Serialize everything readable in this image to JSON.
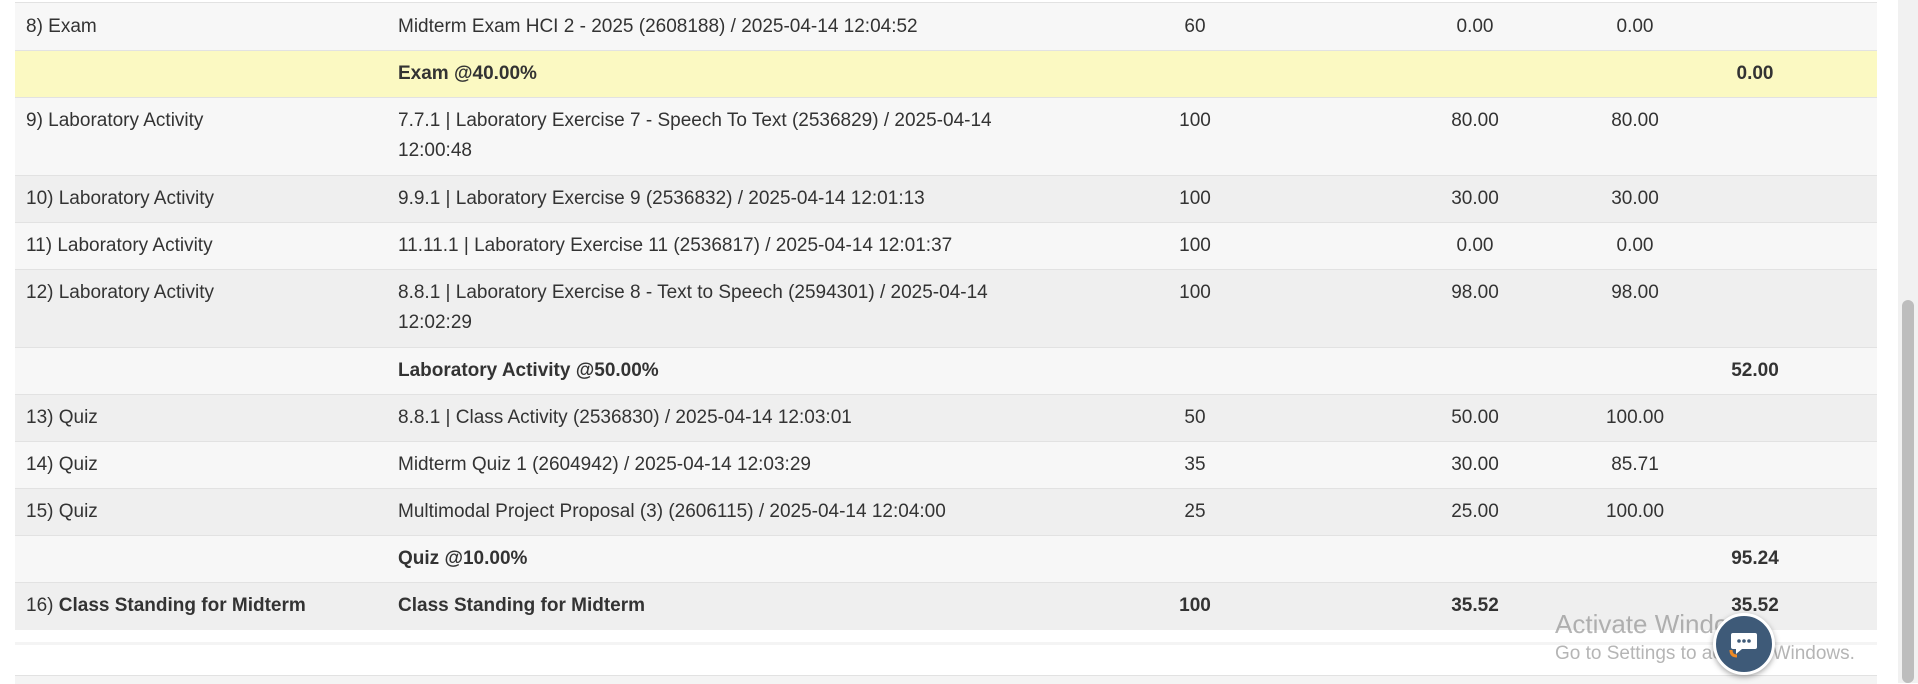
{
  "rows": [
    {
      "kind": "item",
      "name": "8) Exam",
      "desc": "Midterm Exam HCI 2 - 2025 (2608188) / 2025-04-14 12:04:52",
      "items": "60",
      "score": "0.00",
      "pct": "0.00",
      "grade": ""
    },
    {
      "kind": "subtotal",
      "name": "",
      "desc": "Exam @40.00%",
      "items": "",
      "score": "",
      "pct": "",
      "grade": "0.00"
    },
    {
      "kind": "item",
      "name": "9) Laboratory Activity",
      "desc": "7.7.1 | Laboratory Exercise 7 - Speech To Text (2536829) / 2025-04-14 12:00:48",
      "items": "100",
      "score": "80.00",
      "pct": "80.00",
      "grade": ""
    },
    {
      "kind": "item",
      "name": "10) Laboratory Activity",
      "desc": "9.9.1 | Laboratory Exercise 9 (2536832) / 2025-04-14 12:01:13",
      "items": "100",
      "score": "30.00",
      "pct": "30.00",
      "grade": ""
    },
    {
      "kind": "item",
      "name": "11) Laboratory Activity",
      "desc": "11.11.1 | Laboratory Exercise 11 (2536817) / 2025-04-14 12:01:37",
      "items": "100",
      "score": "0.00",
      "pct": "0.00",
      "grade": ""
    },
    {
      "kind": "item",
      "name": "12) Laboratory Activity",
      "desc": "8.8.1 | Laboratory Exercise 8 - Text to Speech (2594301) / 2025-04-14 12:02:29",
      "items": "100",
      "score": "98.00",
      "pct": "98.00",
      "grade": ""
    },
    {
      "kind": "subtotal",
      "name": "",
      "desc": "Laboratory Activity @50.00%",
      "items": "",
      "score": "",
      "pct": "",
      "grade": "52.00"
    },
    {
      "kind": "item",
      "name": "13) Quiz",
      "desc": "8.8.1 | Class Activity (2536830) / 2025-04-14 12:03:01",
      "items": "50",
      "score": "50.00",
      "pct": "100.00",
      "grade": ""
    },
    {
      "kind": "item",
      "name": "14) Quiz",
      "desc": "Midterm Quiz 1 (2604942) / 2025-04-14 12:03:29",
      "items": "35",
      "score": "30.00",
      "pct": "85.71",
      "grade": ""
    },
    {
      "kind": "item",
      "name": "15) Quiz",
      "desc": "Multimodal Project Proposal (3) (2606115) / 2025-04-14 12:04:00",
      "items": "25",
      "score": "25.00",
      "pct": "100.00",
      "grade": ""
    },
    {
      "kind": "subtotal",
      "name": "",
      "desc": "Quiz @10.00%",
      "items": "",
      "score": "",
      "pct": "",
      "grade": "95.24"
    },
    {
      "kind": "total",
      "name_prefix": "16)",
      "name": "Class Standing for Midterm",
      "desc": "Class Standing for Midterm",
      "items": "100",
      "score": "35.52",
      "pct": "",
      "grade": "35.52"
    }
  ],
  "watermark": {
    "title": "Activate Windows",
    "subtitle": "Go to Settings to activate Windows."
  },
  "chat": {
    "icon": "chat-bubble-icon"
  }
}
